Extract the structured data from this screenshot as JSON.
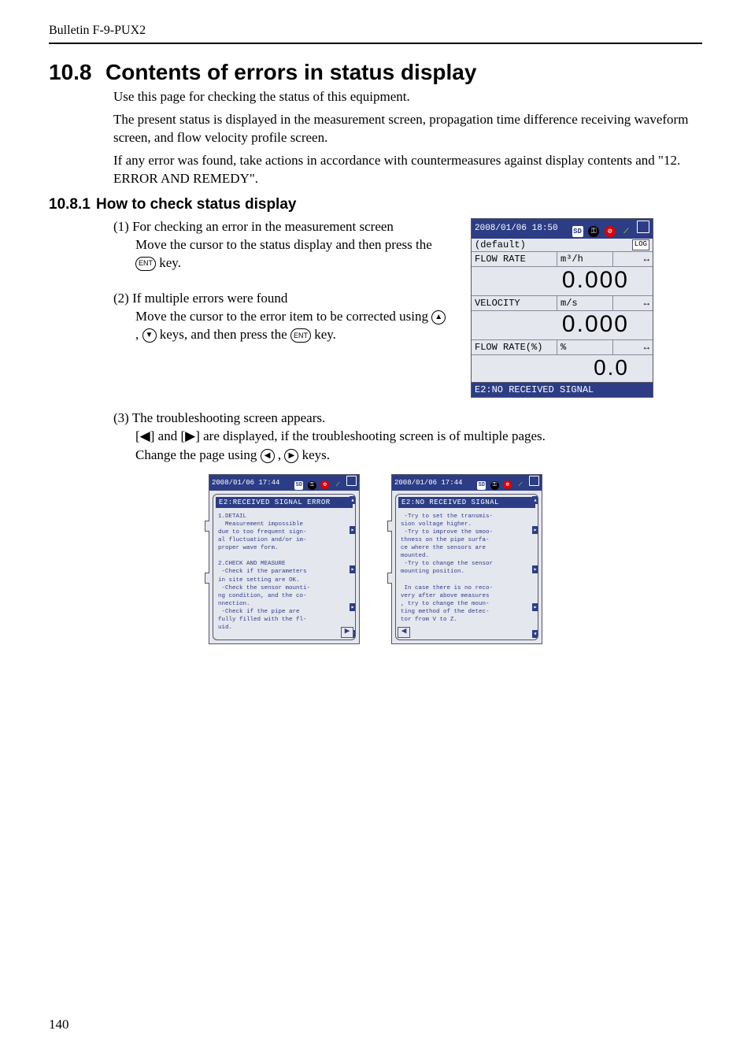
{
  "bulletin": "Bulletin F-9-PUX2",
  "section": {
    "num": "10.8",
    "title": "Contents of errors in status display"
  },
  "intro": {
    "l1": "Use this page for checking the status of this equipment.",
    "l2": "The present status is displayed in the measurement screen, propagation time difference receiving waveform screen, and flow velocity profile screen.",
    "l3": "If any error was found, take actions in accordance with countermeasures against display contents and \"12. ERROR AND REMEDY\"."
  },
  "subsection": {
    "num": "10.8.1",
    "title": "How to check status display"
  },
  "step1": {
    "num": "(1)",
    "head": "For checking an error in the measurement screen",
    "body_a": "Move the cursor to the status display and then press the ",
    "key": "ENT",
    "body_b": " key."
  },
  "step2": {
    "num": "(2)",
    "head": "If multiple errors were found",
    "body_a": "Move the cursor to the error item to be corrected using ",
    "up": "▲",
    "down": "▼",
    "mid": " , ",
    "body_b": " keys, and then press the ",
    "key": "ENT",
    "body_c": " key."
  },
  "step3": {
    "num": "(3)",
    "head": "The troubleshooting screen appears.",
    "l1a": "[",
    "l1_left": "◀",
    "l1b": "] and [",
    "l1_right": "▶",
    "l1c": "] are displayed, if the troubleshooting screen is of multiple pages.",
    "l2a": "Change the page using ",
    "left": "◀",
    "mid": " , ",
    "right": "▶",
    "l2b": " keys."
  },
  "device": {
    "datetime": "2008/01/06 18:50",
    "icons": {
      "sd": "SD",
      "key": "⚿",
      "no": "⊘",
      "ant": "⟋",
      "batt": ""
    },
    "default": "(default)",
    "log": "LOG",
    "rows": [
      {
        "label": "FLOW RATE",
        "unit": "m³/h",
        "value": "0.000"
      },
      {
        "label": "VELOCITY",
        "unit": "m/s",
        "value": "0.000"
      },
      {
        "label": "FLOW RATE(%)",
        "unit": "%",
        "value": "0.0"
      }
    ],
    "arrow": "↔",
    "status": "E2:NO RECEIVED SIGNAL"
  },
  "ts": {
    "datetime": "2008/01/06 17:44",
    "left": {
      "title": "E2:RECEIVED SIGNAL ERROR",
      "body": "1.DETAIL\n  Measurement impossible\ndue to too frequent sign-\nal fluctuation and/or im-\nproper wave form.\n\n2.CHECK AND MEASURE\n -Check if the parameters\nin site setting are OK.\n -Check the sensor mounti-\nng condition, and the co-\nnnection.\n -Check if the pipe are\nfully filled with the fl-\nuid.",
      "pager": "▶"
    },
    "right": {
      "title": "E2:NO RECEIVED SIGNAL",
      "body": " -Try to set the transmis-\nsion voltage higher.\n -Try to improve the smoo-\nthness on the pipe surfa-\nce where the sensors are\nmounted.\n -Try to change the sensor\nmounting position.\n\n In case there is no reco-\nvery after above measures\n, try to change the moun-\nting method of the detec-\ntor from V to Z.",
      "pager": "◀"
    }
  },
  "pagenum": "140"
}
